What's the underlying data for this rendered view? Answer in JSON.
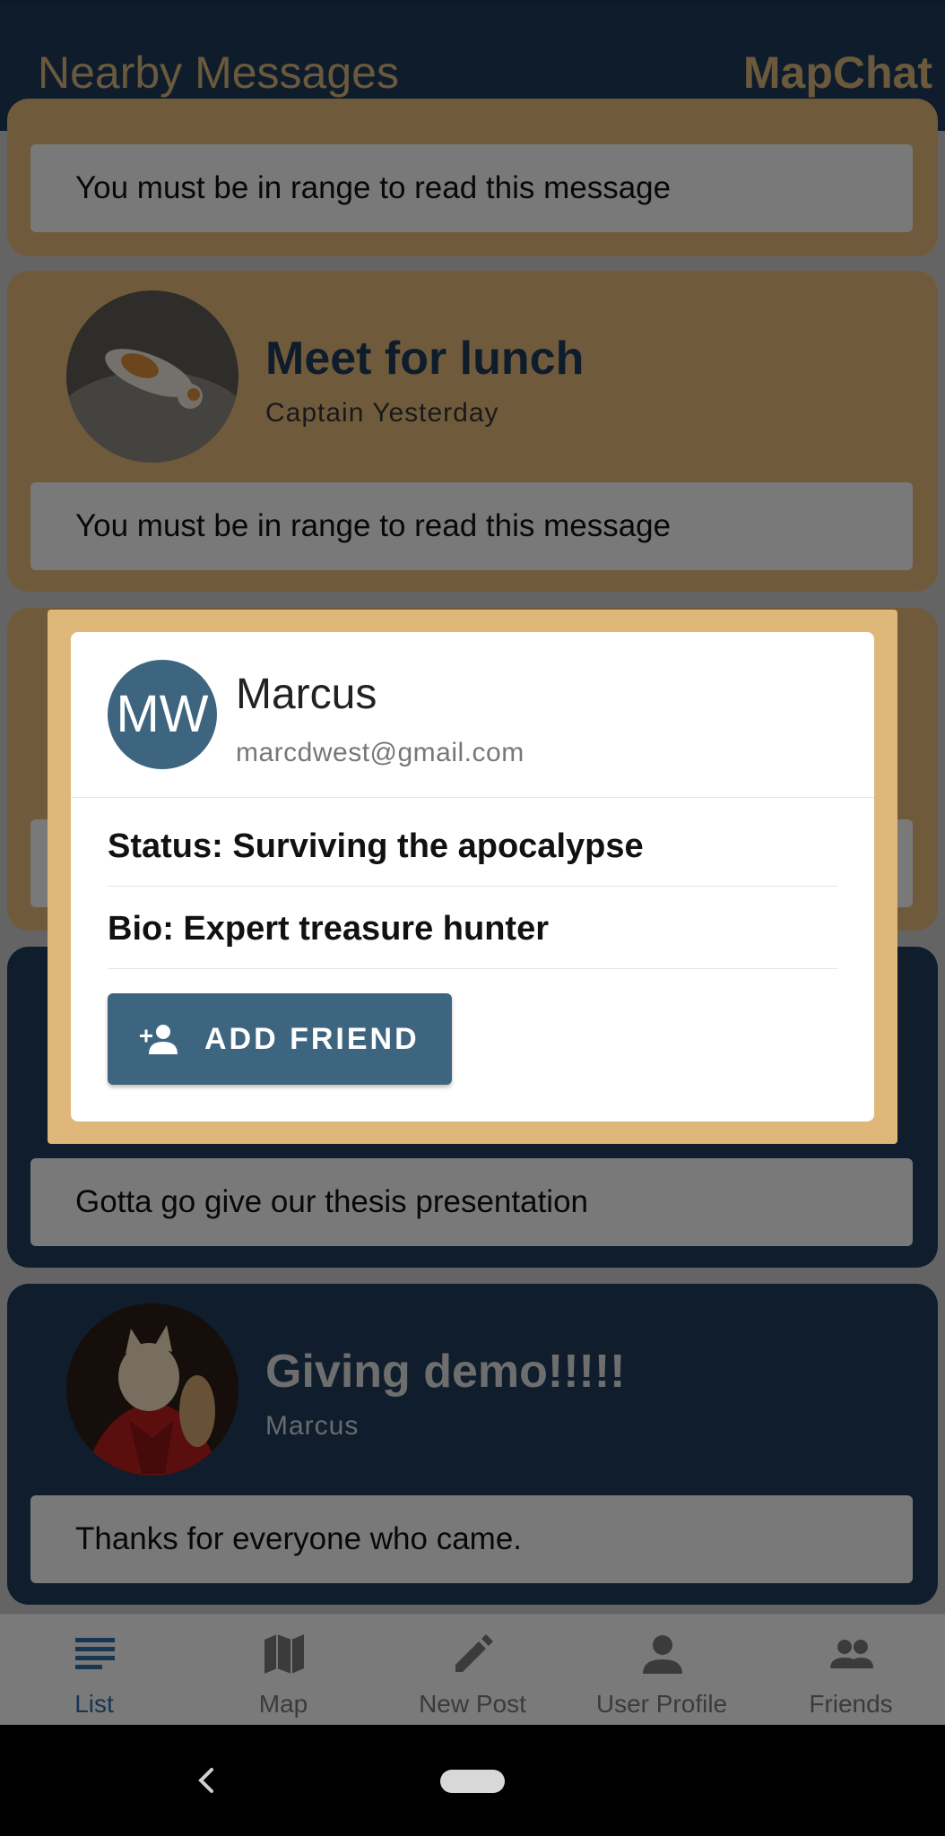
{
  "appbar": {
    "title": "Nearby Messages",
    "brand": "MapChat"
  },
  "cards": {
    "first": {
      "message": "You must be in range to read this message"
    },
    "second": {
      "title": "Meet for lunch",
      "subtitle": "Captain Yesterday",
      "message": "You must be in range to read this message"
    },
    "fourth": {
      "message": "Gotta go give our thesis presentation"
    },
    "fifth": {
      "title": "Giving demo!!!!!",
      "subtitle": "Marcus",
      "message": "Thanks for everyone who came."
    }
  },
  "dialog": {
    "initials": "MW",
    "name": "Marcus",
    "email": "marcdwest@gmail.com",
    "status": "Status: Surviving the apocalypse",
    "bio": "Bio: Expert treasure hunter",
    "add_friend": "ADD FRIEND"
  },
  "bottomnav": {
    "items": [
      {
        "label": "List",
        "icon": "list-icon",
        "active": true
      },
      {
        "label": "Map",
        "icon": "map-icon",
        "active": false
      },
      {
        "label": "New Post",
        "icon": "pencil-icon",
        "active": false
      },
      {
        "label": "User Profile",
        "icon": "person-icon",
        "active": false
      },
      {
        "label": "Friends",
        "icon": "people-icon",
        "active": false
      }
    ]
  },
  "colors": {
    "navy": "#1d3959",
    "gold": "#deb779",
    "button": "#3e6580",
    "active_tab": "#2e6ca4"
  }
}
